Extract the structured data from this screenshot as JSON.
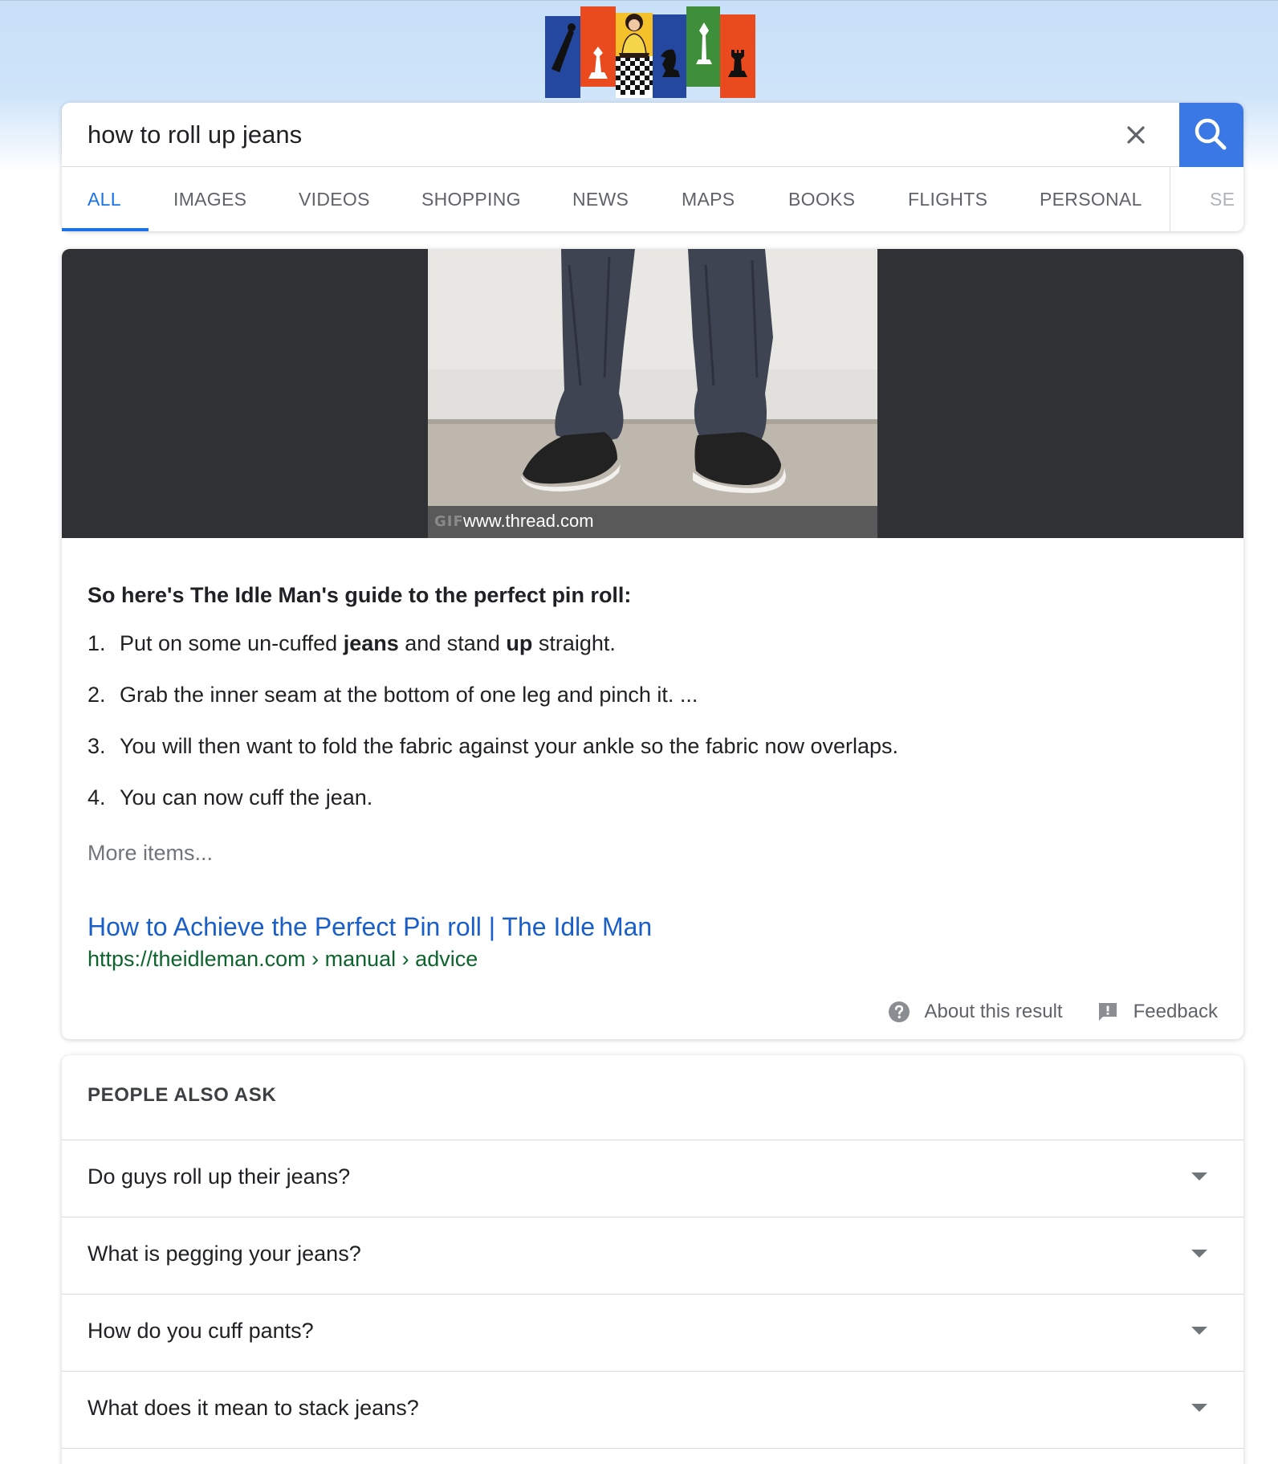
{
  "search": {
    "query": "how to roll up jeans",
    "clear_icon": "close-icon",
    "search_icon": "search-icon"
  },
  "tabs": [
    {
      "label": "ALL",
      "active": true
    },
    {
      "label": "IMAGES"
    },
    {
      "label": "VIDEOS"
    },
    {
      "label": "SHOPPING"
    },
    {
      "label": "NEWS"
    },
    {
      "label": "MAPS"
    },
    {
      "label": "BOOKS"
    },
    {
      "label": "FLIGHTS"
    },
    {
      "label": "PERSONAL"
    },
    {
      "label": "SE"
    }
  ],
  "snippet": {
    "gif_label": "GIF",
    "image_source": "www.thread.com",
    "heading": "So here's The Idle Man's guide to the perfect pin roll:",
    "steps": [
      {
        "num": "1.",
        "pre": "Put on some un-cuffed ",
        "b1": "jeans",
        "mid": " and stand ",
        "b2": "up",
        "post": " straight."
      },
      {
        "num": "2.",
        "text": "Grab the inner seam at the bottom of one leg and pinch it. ..."
      },
      {
        "num": "3.",
        "text": "You will then want to fold the fabric against your ankle so the fabric now overlaps."
      },
      {
        "num": "4.",
        "text": "You can now cuff the jean."
      }
    ],
    "more_items": "More items...",
    "result_title": "How to Achieve the Perfect Pin roll | The Idle Man",
    "result_url": "https://theidleman.com › manual › advice",
    "about_label": "About this result",
    "feedback_label": "Feedback"
  },
  "people_also_ask": {
    "heading": "PEOPLE ALSO ASK",
    "questions": [
      "Do guys roll up their jeans?",
      "What is pegging your jeans?",
      "How do you cuff pants?",
      "What does it mean to stack jeans?"
    ]
  },
  "colors": {
    "accent_blue": "#1a73e8",
    "search_button": "#3a78e6",
    "link": "#1a5fc9",
    "url_green": "#0d652d",
    "media_band": "#303134"
  }
}
